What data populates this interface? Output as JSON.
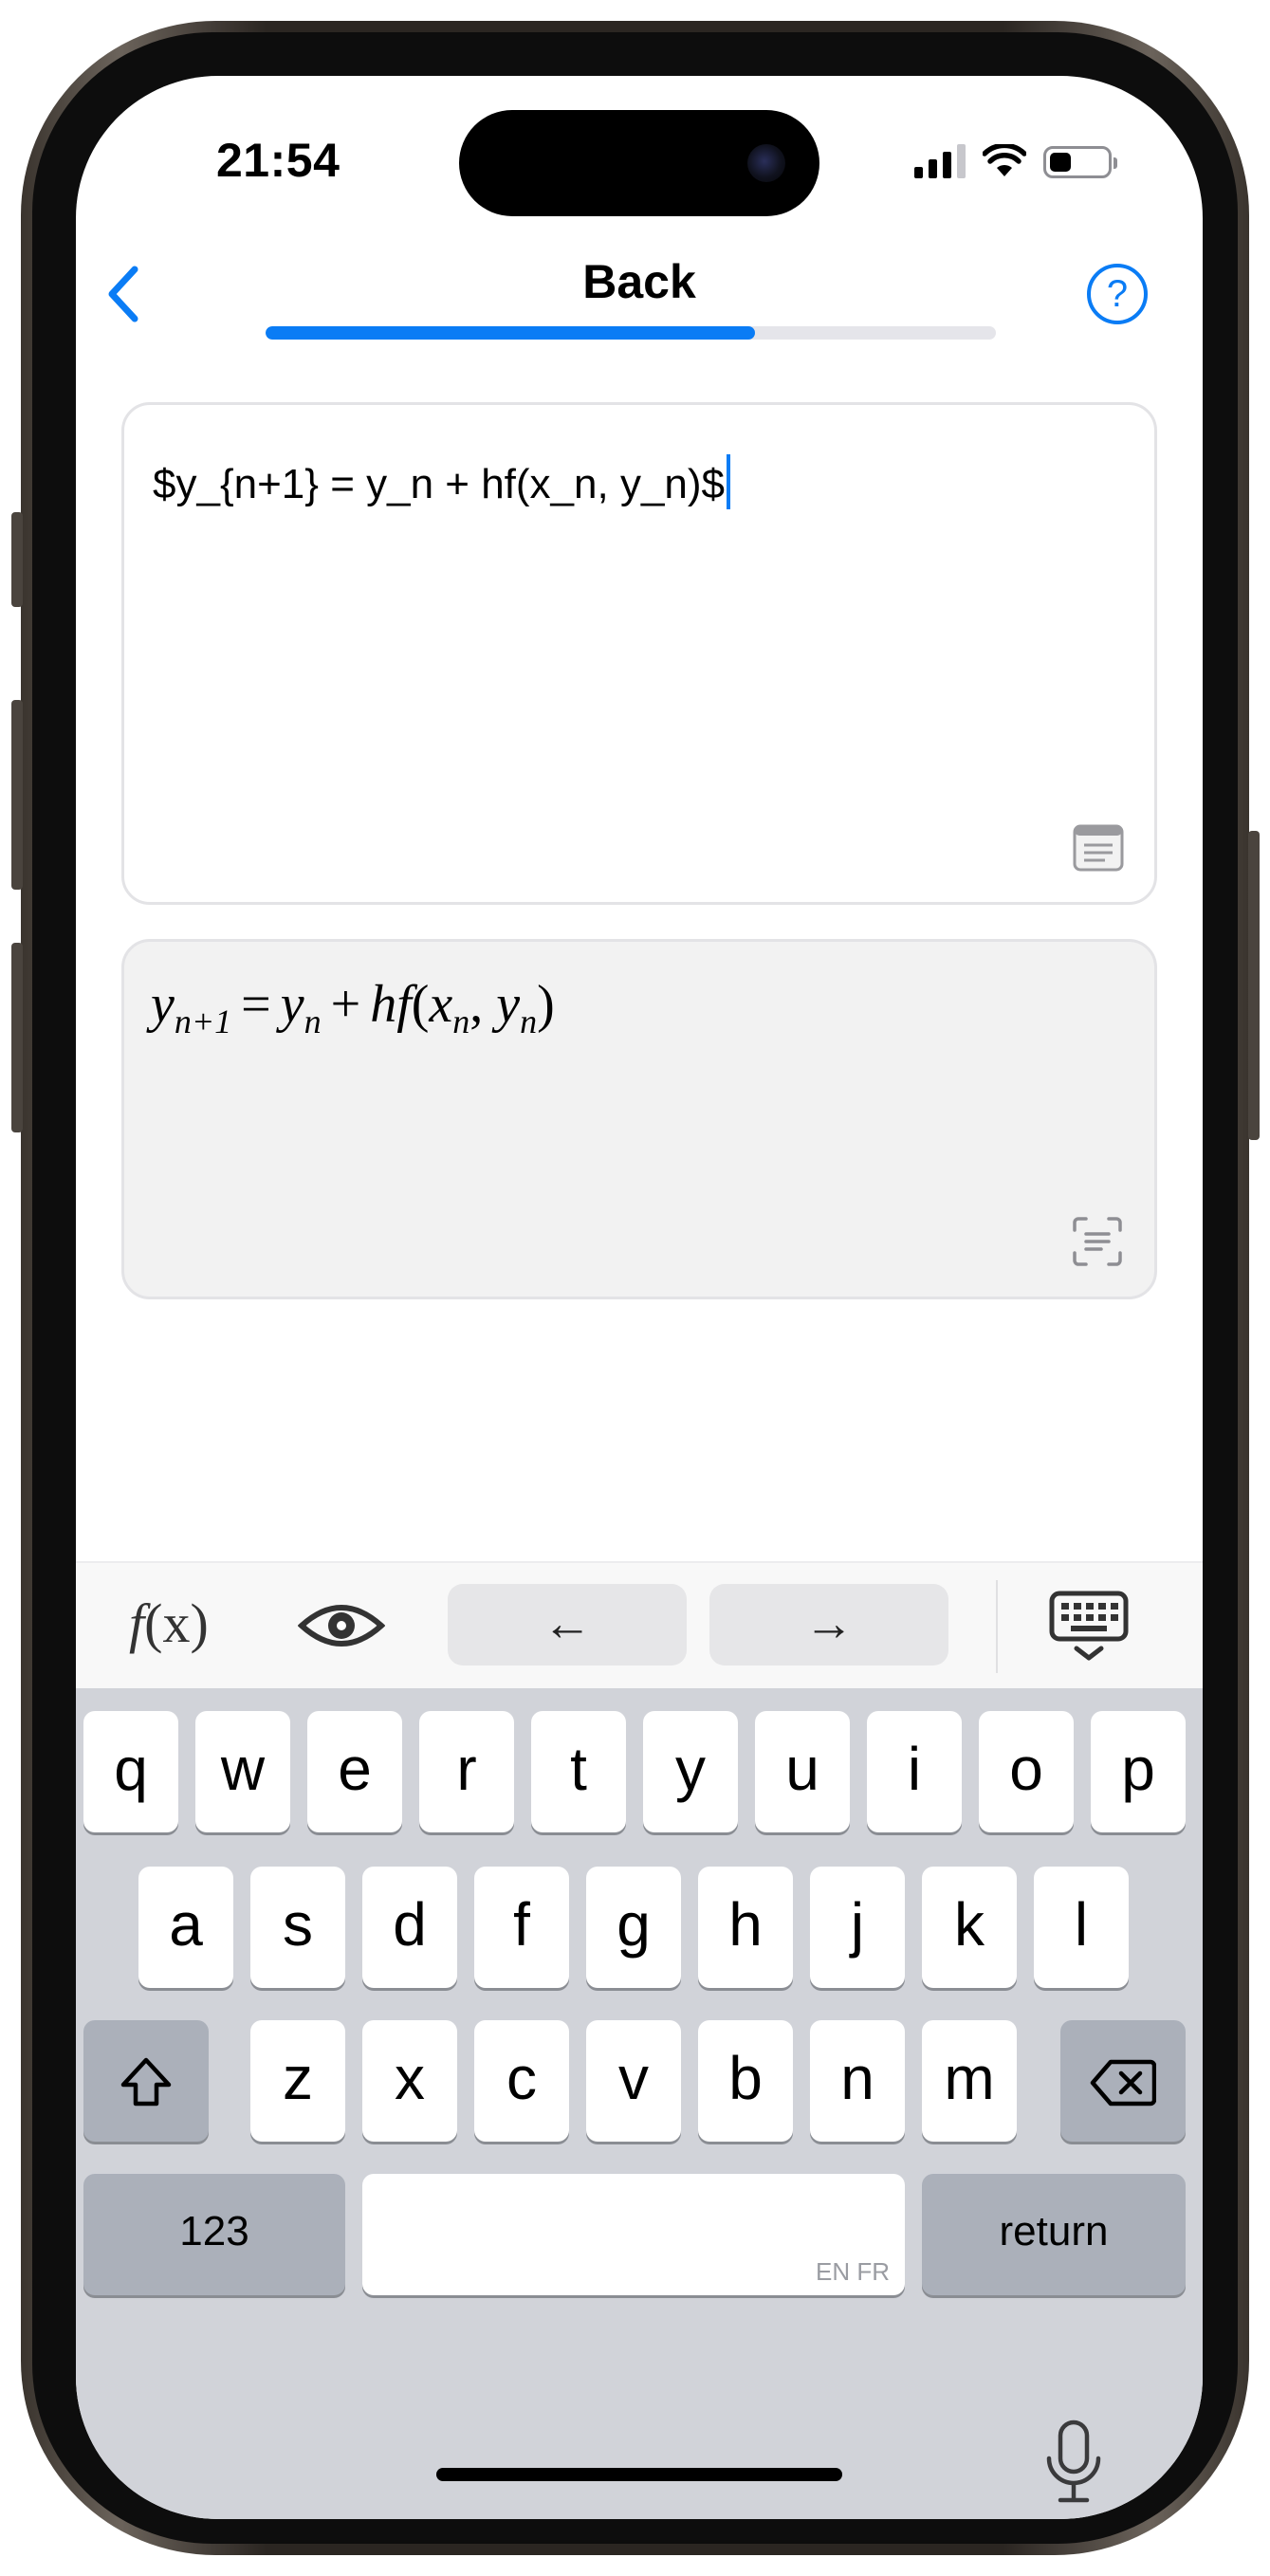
{
  "status_bar": {
    "time": "21:54"
  },
  "nav": {
    "title": "Back",
    "help_label": "?",
    "progress_fraction": 0.67
  },
  "editor": {
    "latex_source": "$y_{n+1} = y_n + hf(x_n, y_n)$"
  },
  "preview": {
    "rendered_formula": "y_{n+1} = y_n + hf(x_n, y_n)",
    "parts": {
      "y": "y",
      "n_plus_1": "n+1",
      "n": "n",
      "eq": "=",
      "plus": "+",
      "hf": "hf",
      "open": "(",
      "x": "x",
      "comma": ",",
      "close": ")"
    }
  },
  "toolbar": {
    "fx_f": "f",
    "fx_x": "(x)",
    "left_arrow": "←",
    "right_arrow": "→"
  },
  "keyboard": {
    "row1": [
      "q",
      "w",
      "e",
      "r",
      "t",
      "y",
      "u",
      "i",
      "o",
      "p"
    ],
    "row2": [
      "a",
      "s",
      "d",
      "f",
      "g",
      "h",
      "j",
      "k",
      "l"
    ],
    "row3": [
      "z",
      "x",
      "c",
      "v",
      "b",
      "n",
      "m"
    ],
    "numbers_key": "123",
    "return_key": "return",
    "space_langs": "EN FR"
  },
  "colors": {
    "accent": "#0a7cf5",
    "keyboard_bg": "#d1d3d9",
    "function_key": "#abb0ba"
  }
}
